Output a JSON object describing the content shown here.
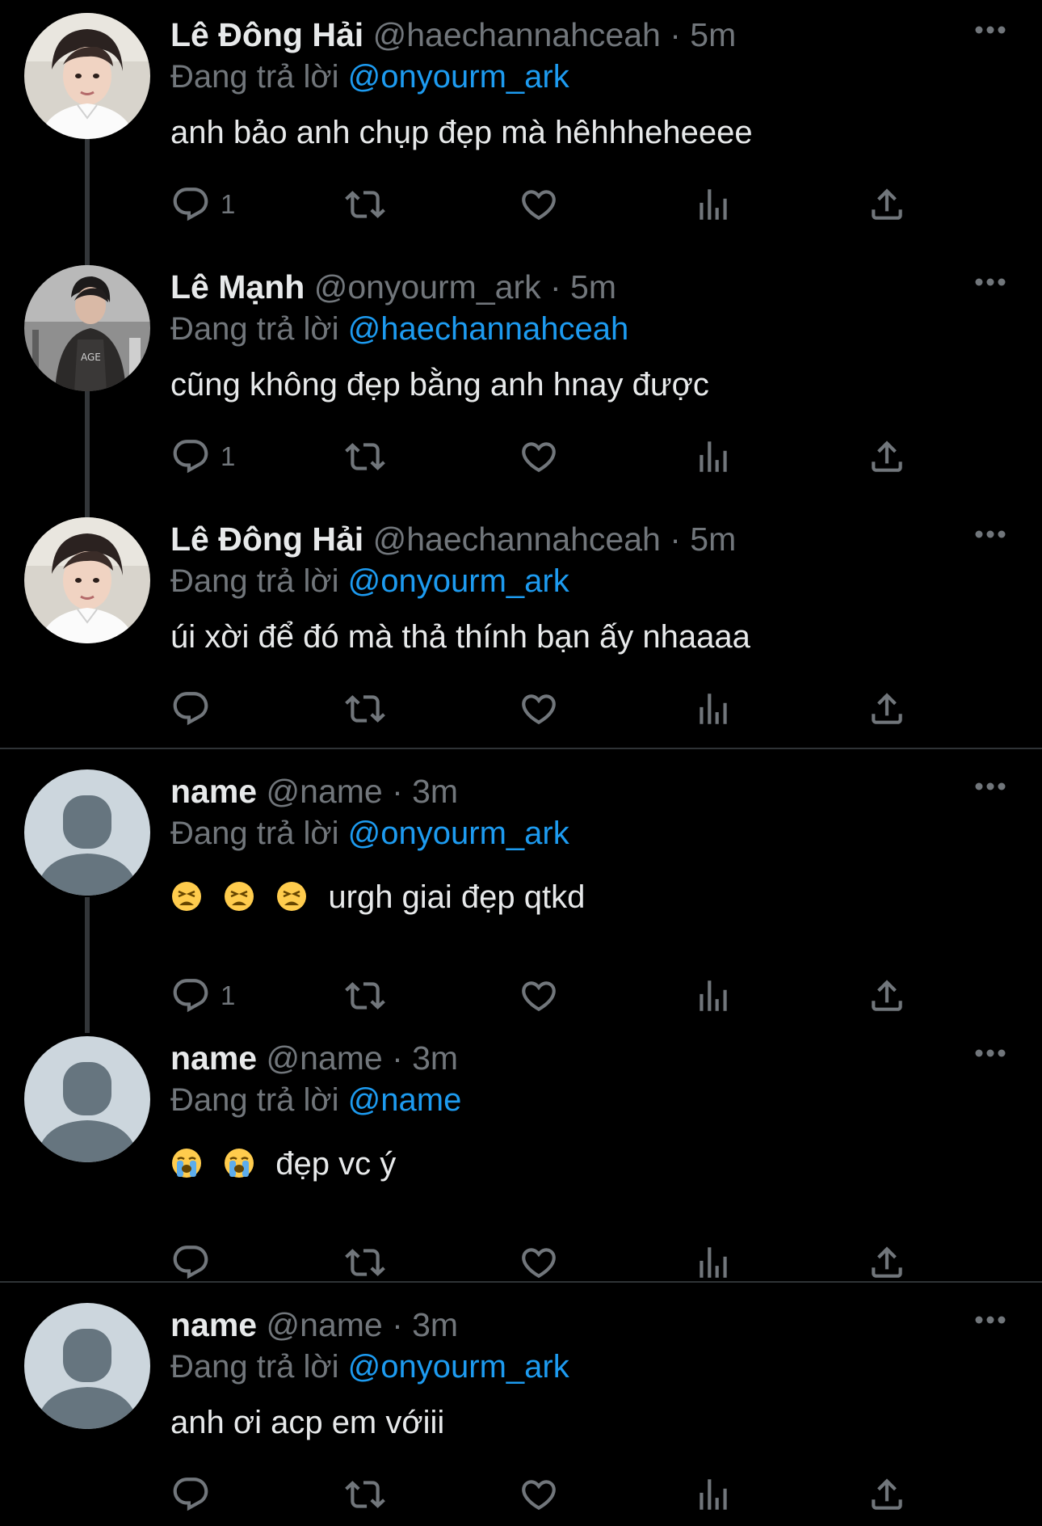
{
  "colors": {
    "background": "#000000",
    "text_primary": "#e7e9ea",
    "text_secondary": "#71767b",
    "accent": "#1d9bf0",
    "divider": "#2f3336",
    "thread_line": "#333639"
  },
  "reply_prefix": "Đang trả lời",
  "tweets": [
    {
      "display_name": "Lê Đông Hải",
      "meta": "@haechannahceah · 5m",
      "reply_to": "@onyourm_ark",
      "text": "anh bảo anh chụp đẹp mà hêhhheheeee",
      "emojis": [],
      "reply_count": "1",
      "avatar_icon": "photo-avatar-icon"
    },
    {
      "display_name": "Lê Mạnh",
      "meta": "@onyourm_ark · 5m",
      "reply_to": "@haechannahceah",
      "text": "cũng không đẹp bằng anh hnay được",
      "emojis": [],
      "reply_count": "1",
      "avatar_icon": "photo-avatar-icon"
    },
    {
      "display_name": "Lê Đông Hải",
      "meta": "@haechannahceah · 5m",
      "reply_to": "@onyourm_ark",
      "text": "úi xời để đó mà thả thính bạn ấy nhaaaa",
      "emojis": [],
      "reply_count": "",
      "avatar_icon": "photo-avatar-icon"
    },
    {
      "display_name": "name",
      "meta": "@name · 3m",
      "reply_to": "@onyourm_ark",
      "text": "urgh giai đẹp qtkd",
      "emojis": [
        "tired-face-emoji",
        "tired-face-emoji",
        "tired-face-emoji"
      ],
      "reply_count": "1",
      "avatar_icon": "default-profile-icon"
    },
    {
      "display_name": "name",
      "meta": "@name · 3m",
      "reply_to": "@name",
      "text": "đẹp vc ý",
      "emojis": [
        "loudly-crying-face-emoji",
        "loudly-crying-face-emoji"
      ],
      "reply_count": "",
      "avatar_icon": "default-profile-icon"
    },
    {
      "display_name": "name",
      "meta": "@name · 3m",
      "reply_to": "@onyourm_ark",
      "text": "anh ơi acp em vớiii",
      "emojis": [],
      "reply_count": "",
      "avatar_icon": "default-profile-icon"
    }
  ],
  "action_icons": [
    "reply-icon",
    "retweet-icon",
    "like-icon",
    "views-icon",
    "share-icon"
  ]
}
